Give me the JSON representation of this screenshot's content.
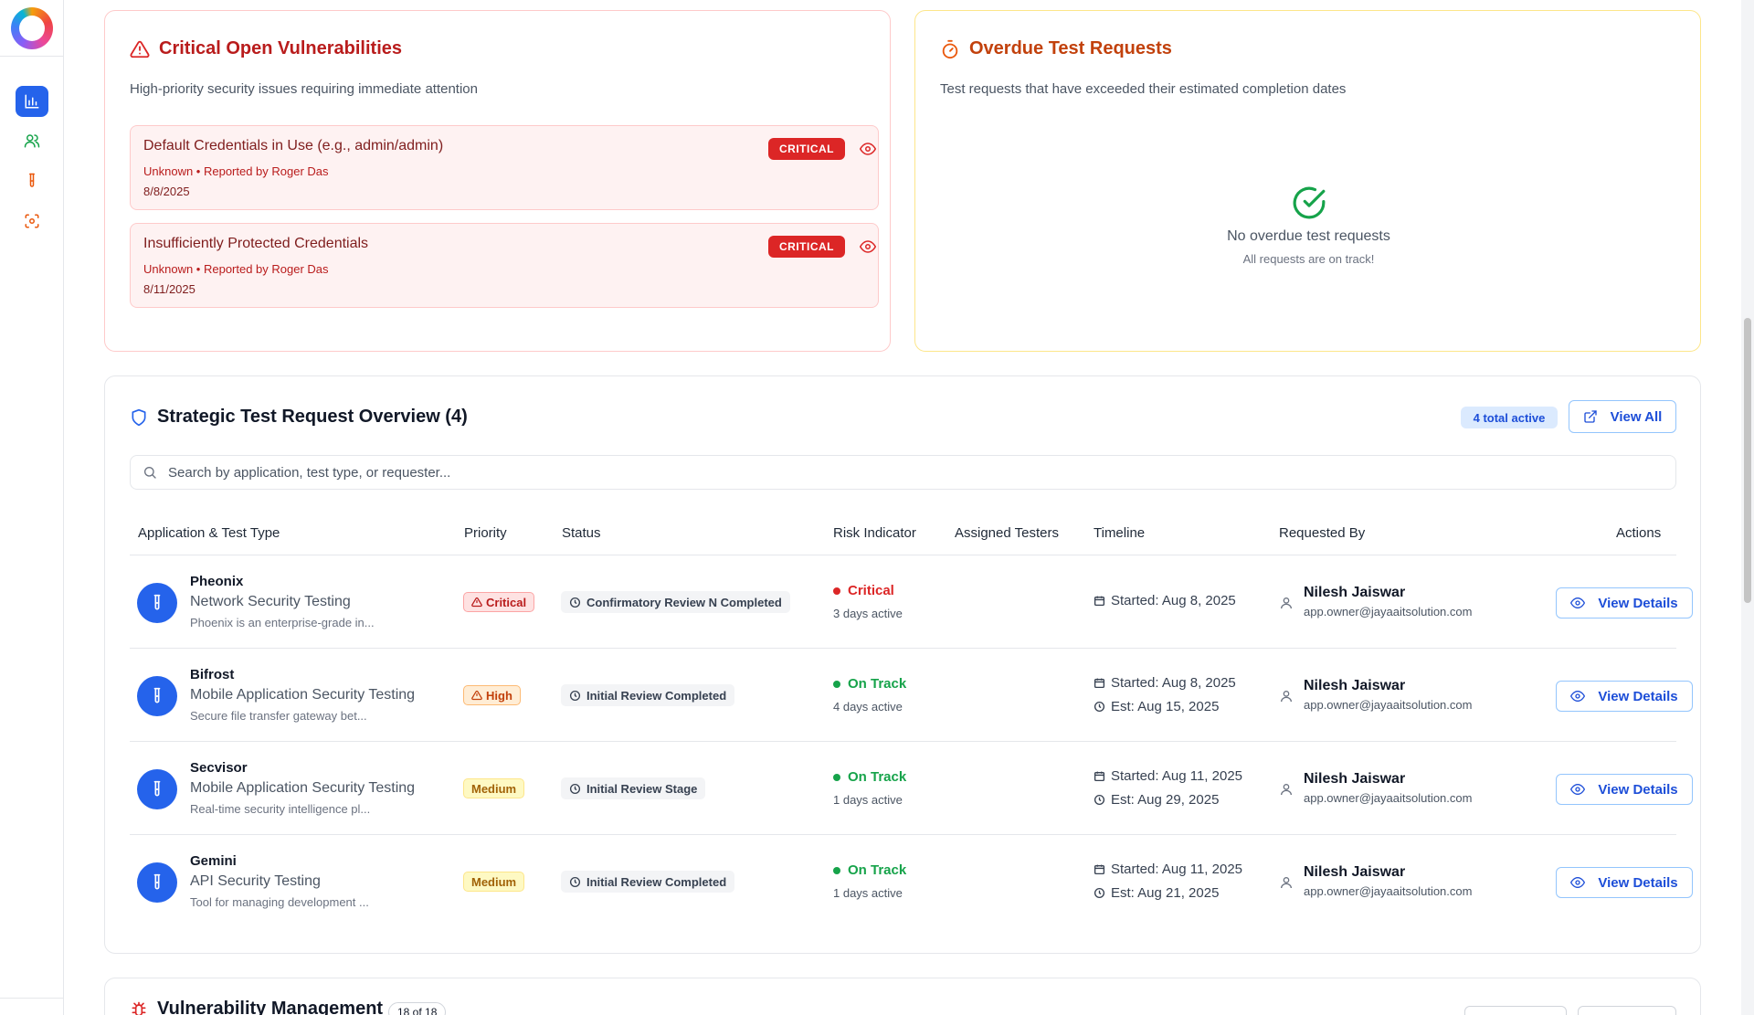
{
  "colors": {
    "brand_blue": "#2563eb",
    "critical_red": "#dc2626",
    "overdue_orange": "#c2410c",
    "success_green": "#16a34a"
  },
  "sidebar": {
    "items": [
      {
        "name": "dashboard",
        "icon": "bar-chart-icon",
        "active": true
      },
      {
        "name": "users",
        "icon": "users-icon",
        "active": false
      },
      {
        "name": "test-requests",
        "icon": "test-tube-icon",
        "active": false
      },
      {
        "name": "scanner",
        "icon": "scan-icon",
        "active": false
      }
    ]
  },
  "critical_vulns": {
    "title": "Critical Open Vulnerabilities",
    "subtitle": "High-priority security issues requiring immediate attention",
    "items": [
      {
        "title": "Default Credentials in Use (e.g., admin/admin)",
        "meta": "Unknown • Reported by Roger Das",
        "date": "8/8/2025",
        "severity": "CRITICAL"
      },
      {
        "title": "Insufficiently Protected Credentials",
        "meta": "Unknown • Reported by Roger Das",
        "date": "8/11/2025",
        "severity": "CRITICAL"
      }
    ]
  },
  "overdue": {
    "title": "Overdue Test Requests",
    "subtitle": "Test requests that have exceeded their estimated completion dates",
    "empty_title": "No overdue test requests",
    "empty_sub": "All requests are on track!"
  },
  "strategic": {
    "title": "Strategic Test Request Overview (4)",
    "total_badge": "4 total active",
    "view_all": "View All",
    "search_placeholder": "Search by application, test type, or requester...",
    "columns": [
      "Application & Test Type",
      "Priority",
      "Status",
      "Risk Indicator",
      "Assigned Testers",
      "Timeline",
      "Requested By",
      "Actions"
    ],
    "rows": [
      {
        "app": "Pheonix",
        "type": "Network Security Testing",
        "desc": "Phoenix is an enterprise-grade in...",
        "priority": "Critical",
        "status": "Confirmatory Review N Completed",
        "risk": "Critical",
        "days": "3 days active",
        "started": "Started: Aug 8, 2025",
        "est": "",
        "requester": "Nilesh Jaiswar",
        "email": "app.owner@jayaaitsolution.com",
        "action": "View Details"
      },
      {
        "app": "Bifrost",
        "type": "Mobile Application Security Testing",
        "desc": "Secure file transfer gateway bet...",
        "priority": "High",
        "status": "Initial Review Completed",
        "risk": "On Track",
        "days": "4 days active",
        "started": "Started: Aug 8, 2025",
        "est": "Est: Aug 15, 2025",
        "requester": "Nilesh Jaiswar",
        "email": "app.owner@jayaaitsolution.com",
        "action": "View Details"
      },
      {
        "app": "Secvisor",
        "type": "Mobile Application Security Testing",
        "desc": "Real-time security intelligence pl...",
        "priority": "Medium",
        "status": "Initial Review Stage",
        "risk": "On Track",
        "days": "1 days active",
        "started": "Started: Aug 11, 2025",
        "est": "Est: Aug 29, 2025",
        "requester": "Nilesh Jaiswar",
        "email": "app.owner@jayaaitsolution.com",
        "action": "View Details"
      },
      {
        "app": "Gemini",
        "type": "API Security Testing",
        "desc": "Tool for managing development ...",
        "priority": "Medium",
        "status": "Initial Review Completed",
        "risk": "On Track",
        "days": "1 days active",
        "started": "Started: Aug 11, 2025",
        "est": "Est: Aug 21, 2025",
        "requester": "Nilesh Jaiswar",
        "email": "app.owner@jayaaitsolution.com",
        "action": "View Details"
      }
    ]
  },
  "vuln_mgmt": {
    "title": "Vulnerability Management",
    "count": "18 of 18"
  }
}
